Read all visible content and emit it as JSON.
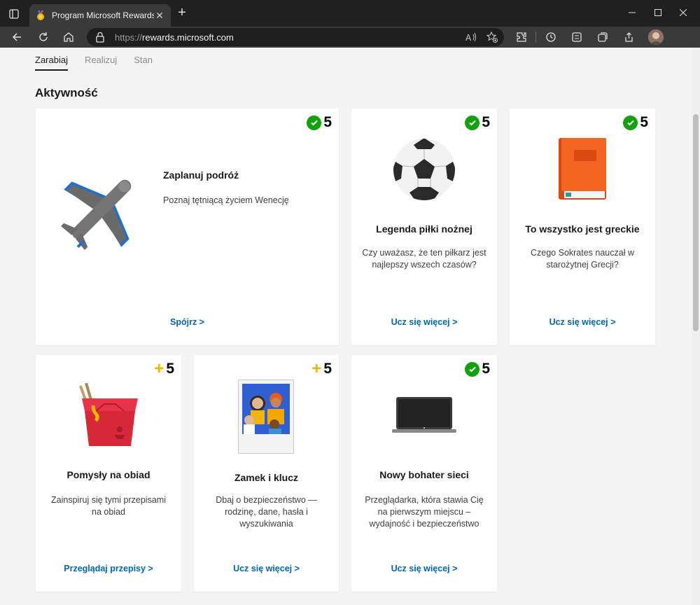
{
  "browser": {
    "tab_title": "Program Microsoft Rewards",
    "url_prefix": "https://",
    "url_host": "rewards.microsoft.com"
  },
  "subnav": {
    "items": [
      {
        "label": "Zarabiaj",
        "active": true
      },
      {
        "label": "Realizuj",
        "active": false
      },
      {
        "label": "Stan",
        "active": false
      }
    ]
  },
  "section_title": "Aktywność",
  "cards": [
    {
      "points": "5",
      "status": "completed",
      "title": "Zaplanuj podróż",
      "desc": "Poznaj tętniącą życiem Wenecję",
      "link": "Spójrz >",
      "icon": "airplane-illustration"
    },
    {
      "points": "5",
      "status": "completed",
      "title": "Legenda piłki nożnej",
      "desc": "Czy uważasz, że ten piłkarz jest najlepszy wszech czasów?",
      "link": "Ucz się więcej >",
      "icon": "soccer-ball-illustration"
    },
    {
      "points": "5",
      "status": "completed",
      "title": "To wszystko jest greckie",
      "desc": "Czego Sokrates nauczał w starożytnej Grecji?",
      "link": "Ucz się więcej >",
      "icon": "book-illustration"
    },
    {
      "points": "5",
      "status": "available",
      "title": "Pomysły na obiad",
      "desc": "Zainspiruj się tymi przepisami na obiad",
      "link": "Przeglądaj przepisy >",
      "icon": "takeout-box-illustration"
    },
    {
      "points": "5",
      "status": "available",
      "title": "Zamek i klucz",
      "desc": "Dbaj o bezpieczeństwo — rodzinę, dane, hasła i wyszukiwania",
      "link": "Ucz się więcej >",
      "icon": "family-photo-illustration"
    },
    {
      "points": "5",
      "status": "completed",
      "title": "Nowy bohater sieci",
      "desc": "Przeglądarka, która stawia Cię na pierwszym miejscu – wydajność i bezpieczeństwo",
      "link": "Ucz się więcej >",
      "icon": "laptop-illustration"
    }
  ],
  "colors": {
    "completed_check": "#13a10e",
    "available_plus": "#f2b600",
    "link": "#0067b8"
  }
}
